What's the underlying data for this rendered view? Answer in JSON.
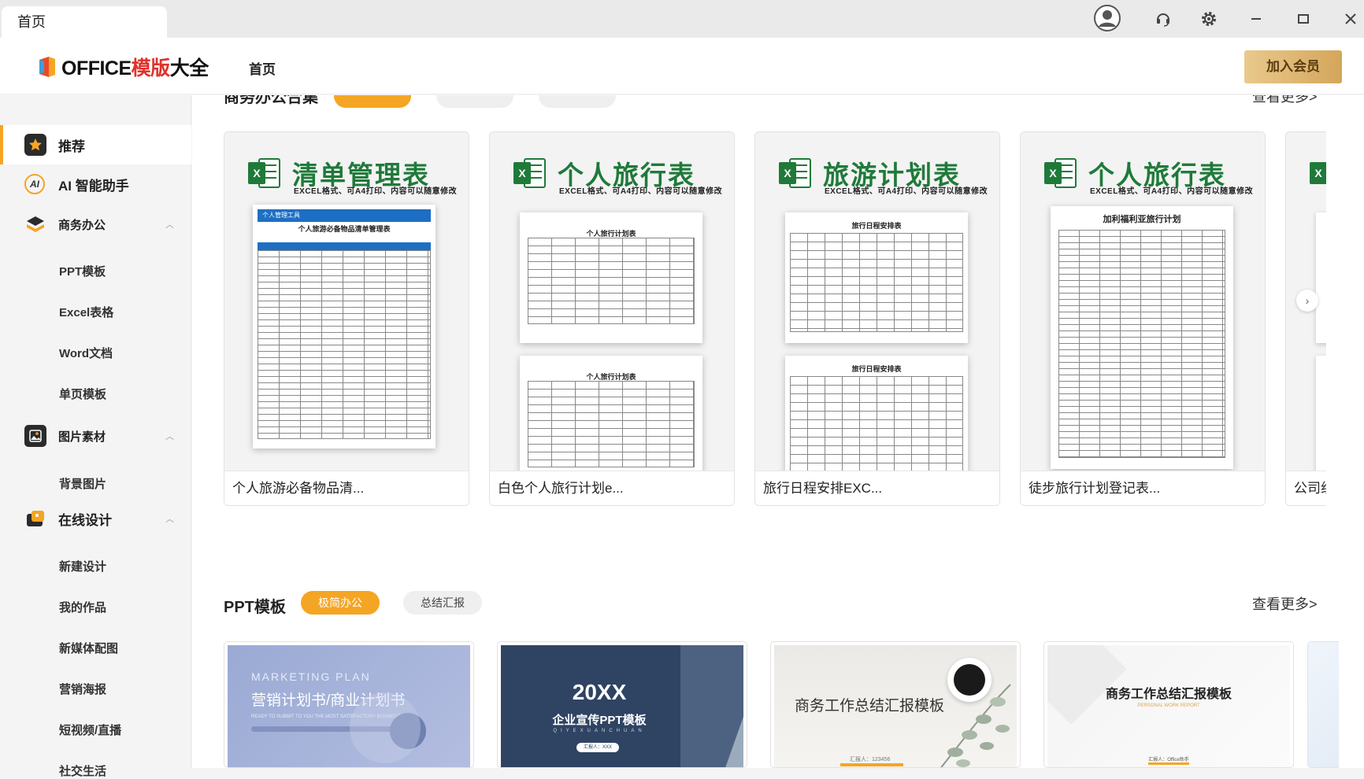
{
  "window": {
    "tab_label": "首页",
    "controls": [
      "user-icon",
      "headset-icon",
      "gear-icon",
      "minimize-icon",
      "maximize-icon",
      "close-icon"
    ]
  },
  "header": {
    "logo_prefix": "OFFICE",
    "logo_red": "模版",
    "logo_suffix": "大全",
    "nav_home": "首页",
    "vip_button": "加入会员"
  },
  "sidebar": {
    "items": [
      {
        "label": "推荐",
        "icon": "star-icon",
        "active": true
      },
      {
        "label": "AI 智能助手",
        "icon": "ai-icon"
      },
      {
        "label": "商务办公",
        "icon": "layers-icon",
        "expandable": true
      },
      {
        "label": "图片素材",
        "icon": "image-icon",
        "expandable": true
      },
      {
        "label": "在线设计",
        "icon": "design-icon",
        "expandable": true
      }
    ],
    "business_sub": [
      "PPT模板",
      "Excel表格",
      "Word文档",
      "单页模板"
    ],
    "image_sub": [
      "背景图片"
    ],
    "design_sub": [
      "新建设计",
      "我的作品",
      "新媒体配图",
      "营销海报",
      "短视频/直播",
      "社交生活"
    ]
  },
  "section1": {
    "title": "商务办公合集",
    "more": "查看更多>",
    "cards": [
      {
        "badge_title": "清单管理表",
        "sub": "EXCEL格式、可A4打印、内容可以随意修改",
        "caption": "个人旅游必备物品清...",
        "sheet_title": "个人旅游必备物品清单管理表",
        "sheet_header": "个人管理工具"
      },
      {
        "badge_title": "个人旅行表",
        "sub": "EXCEL格式、可A4打印、内容可以随意修改",
        "caption": "白色个人旅行计划e...",
        "sheet_title": "个人旅行计划表"
      },
      {
        "badge_title": "旅游计划表",
        "sub": "EXCEL格式、可A4打印、内容可以随意修改",
        "caption": "旅行日程安排EXC...",
        "sheet_title": "旅行日程安排表"
      },
      {
        "badge_title": "个人旅行表",
        "sub": "EXCEL格式、可A4打印、内容可以随意修改",
        "caption": "徒步旅行计划登记表...",
        "sheet_title": "加利福利亚旅行计划"
      },
      {
        "caption": "公司组"
      }
    ]
  },
  "section2": {
    "title": "PPT模板",
    "tabs": [
      "极简办公",
      "总结汇报"
    ],
    "more": "查看更多>",
    "cards": [
      {
        "eyebrow": "MARKETING PLAN",
        "title": "营销计划书/商业计划书",
        "sub": "READY TO SUBMIT TO YOU THE MOST SATISFACTORY BUSINESS PLAN"
      },
      {
        "title": "20XX",
        "sub": "企业宣传PPT模板",
        "spaced": "QIYEXUANCHUAN",
        "tag": "汇报人：XXX"
      },
      {
        "title": "商务工作总结汇报模板",
        "sub": "汇报人：123456"
      },
      {
        "title": "商务工作总结汇报模板",
        "sub": "PERSONAL WORK REPORT",
        "tag": "汇报人：Office助手"
      }
    ]
  }
}
